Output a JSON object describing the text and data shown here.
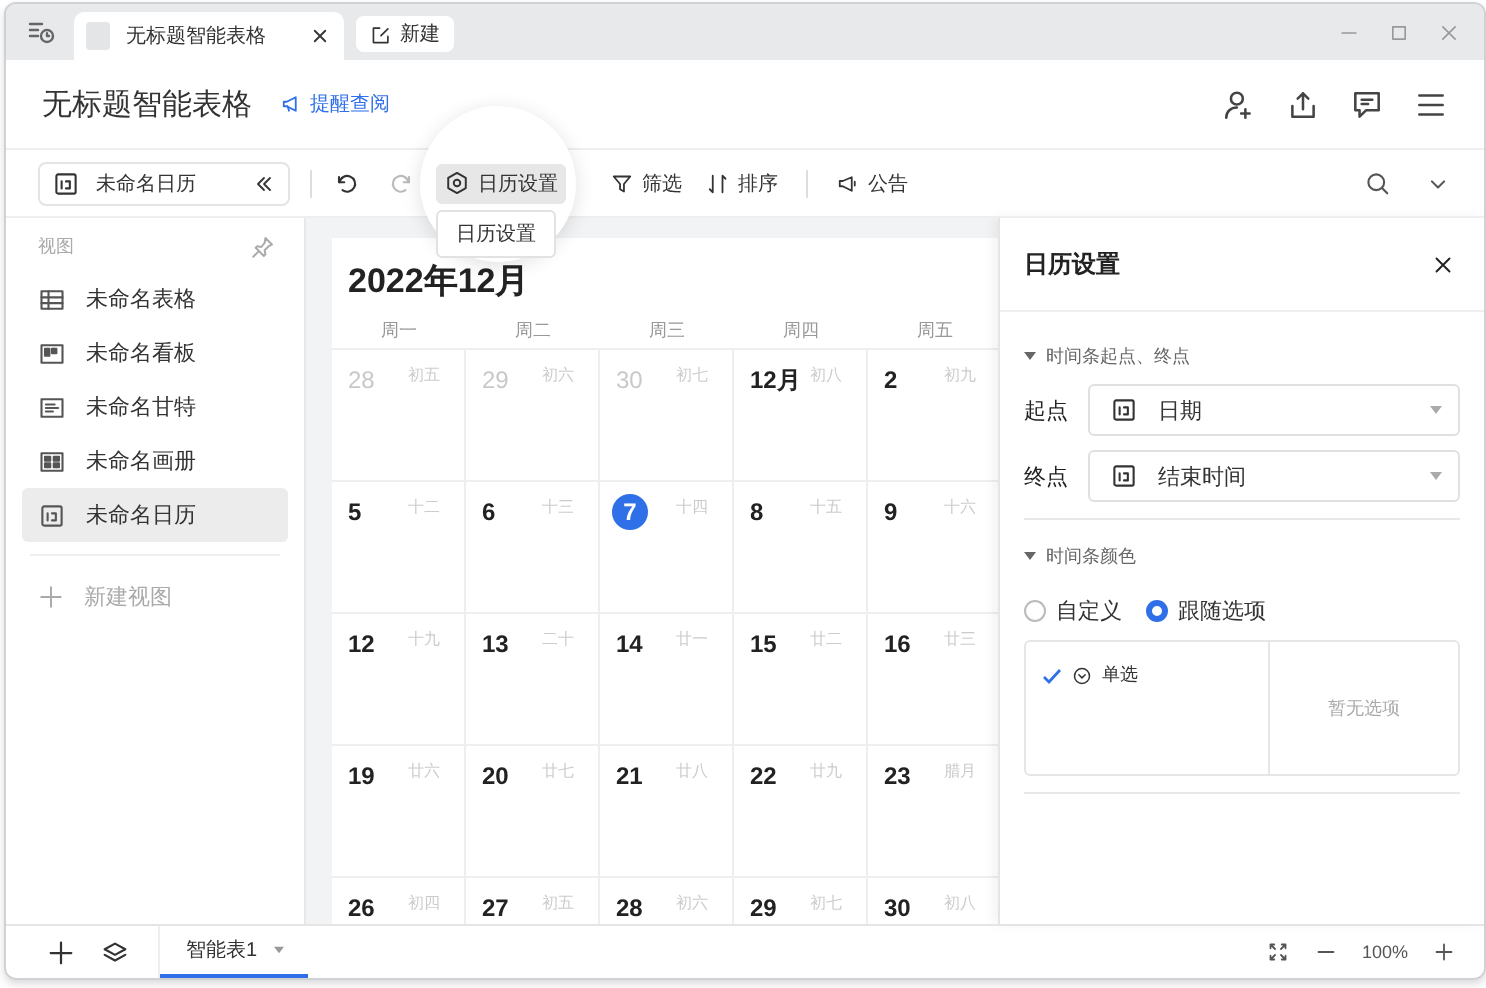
{
  "window": {
    "tabs": [
      {
        "label": "无标题智能表格",
        "selected": true
      }
    ],
    "new_tab_button": "新建"
  },
  "header": {
    "title": "无标题智能表格",
    "remind_link": "提醒查阅"
  },
  "toolbar": {
    "view_selector": "未命名日历",
    "calendar_settings": "日历设置",
    "tooltip": "日历设置",
    "filter": "筛选",
    "sort": "排序",
    "announcement": "公告"
  },
  "sidebar": {
    "label": "视图",
    "items": [
      {
        "label": "未命名表格",
        "kind": "grid",
        "selected": false
      },
      {
        "label": "未命名看板",
        "kind": "kanban",
        "selected": false
      },
      {
        "label": "未命名甘特",
        "kind": "gantt",
        "selected": false
      },
      {
        "label": "未命名画册",
        "kind": "gallery",
        "selected": false
      },
      {
        "label": "未命名日历",
        "kind": "calendar",
        "selected": true
      }
    ],
    "new_view": "新建视图"
  },
  "calendar": {
    "title": "2022年12月",
    "weekdays": [
      "周一",
      "周二",
      "周三",
      "周四",
      "周五"
    ],
    "weeks": [
      [
        {
          "day": "28",
          "lunar": "初五",
          "in_month": false,
          "today": false
        },
        {
          "day": "29",
          "lunar": "初六",
          "in_month": false,
          "today": false
        },
        {
          "day": "30",
          "lunar": "初七",
          "in_month": false,
          "today": false
        },
        {
          "day": "12月",
          "lunar": "初八",
          "in_month": true,
          "today": false
        },
        {
          "day": "2",
          "lunar": "初九",
          "in_month": true,
          "today": false
        }
      ],
      [
        {
          "day": "5",
          "lunar": "十二",
          "in_month": true,
          "today": false
        },
        {
          "day": "6",
          "lunar": "十三",
          "in_month": true,
          "today": false
        },
        {
          "day": "7",
          "lunar": "十四",
          "in_month": true,
          "today": true
        },
        {
          "day": "8",
          "lunar": "十五",
          "in_month": true,
          "today": false
        },
        {
          "day": "9",
          "lunar": "十六",
          "in_month": true,
          "today": false
        }
      ],
      [
        {
          "day": "12",
          "lunar": "十九",
          "in_month": true,
          "today": false
        },
        {
          "day": "13",
          "lunar": "二十",
          "in_month": true,
          "today": false
        },
        {
          "day": "14",
          "lunar": "廿一",
          "in_month": true,
          "today": false
        },
        {
          "day": "15",
          "lunar": "廿二",
          "in_month": true,
          "today": false
        },
        {
          "day": "16",
          "lunar": "廿三",
          "in_month": true,
          "today": false
        }
      ],
      [
        {
          "day": "19",
          "lunar": "廿六",
          "in_month": true,
          "today": false
        },
        {
          "day": "20",
          "lunar": "廿七",
          "in_month": true,
          "today": false
        },
        {
          "day": "21",
          "lunar": "廿八",
          "in_month": true,
          "today": false
        },
        {
          "day": "22",
          "lunar": "廿九",
          "in_month": true,
          "today": false
        },
        {
          "day": "23",
          "lunar": "腊月",
          "in_month": true,
          "today": false
        }
      ],
      [
        {
          "day": "26",
          "lunar": "初四",
          "in_month": true,
          "today": false
        },
        {
          "day": "27",
          "lunar": "初五",
          "in_month": true,
          "today": false
        },
        {
          "day": "28",
          "lunar": "初六",
          "in_month": true,
          "today": false
        },
        {
          "day": "29",
          "lunar": "初七",
          "in_month": true,
          "today": false
        },
        {
          "day": "30",
          "lunar": "初八",
          "in_month": true,
          "today": false
        }
      ]
    ]
  },
  "settings_panel": {
    "title": "日历设置",
    "timeline_section": {
      "title": "时间条起点、终点",
      "expanded": true,
      "fields": [
        {
          "label": "起点",
          "value": "日期"
        },
        {
          "label": "终点",
          "value": "结束时间"
        }
      ]
    },
    "color_section": {
      "title": "时间条颜色",
      "expanded": true,
      "options": [
        {
          "label": "自定义",
          "selected": false
        },
        {
          "label": "跟随选项",
          "selected": true
        }
      ],
      "fields": [
        {
          "label": "单选",
          "checked": true
        }
      ],
      "empty_text": "暂无选项"
    }
  },
  "bottom_bar": {
    "sheet_tabs": [
      {
        "label": "智能表1",
        "selected": true
      }
    ],
    "zoom": "100%"
  }
}
